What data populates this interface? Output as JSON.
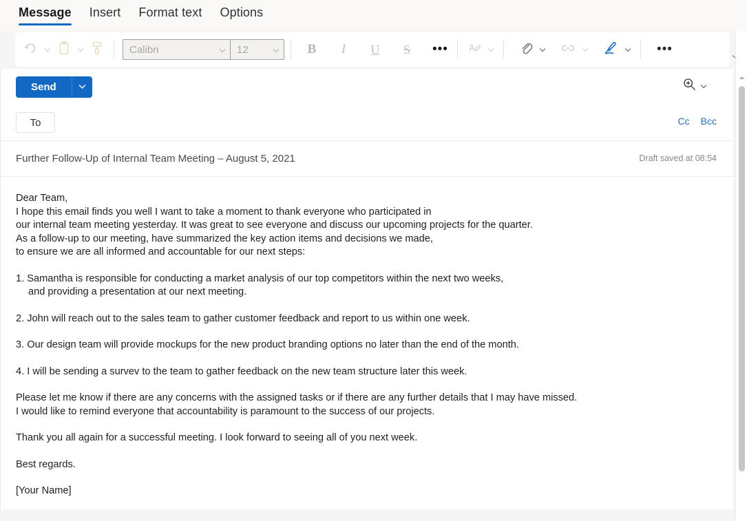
{
  "window": {
    "theme_accent": "#1268c3",
    "background": "#ffffff"
  },
  "tabs": [
    {
      "label": "Message",
      "selected": true
    },
    {
      "label": "Insert",
      "selected": false
    },
    {
      "label": "Format text",
      "selected": false
    },
    {
      "label": "Options",
      "selected": false
    }
  ],
  "ribbon": {
    "undo": {
      "name": "undo-icon",
      "enabled": false
    },
    "paste": {
      "name": "paste-clipboard-icon",
      "enabled": false
    },
    "format_painter": {
      "name": "format-painter-icon",
      "enabled": false
    },
    "font_name": {
      "value": "Calibri",
      "enabled": false
    },
    "font_size": {
      "value": "12",
      "enabled": false
    },
    "bold": {
      "label": "B",
      "enabled": false
    },
    "italic": {
      "label": "I",
      "enabled": false
    },
    "underline": {
      "label": "U",
      "enabled": false
    },
    "strikethrough": {
      "label": "S",
      "enabled": false
    },
    "more_font": {
      "label": "•••"
    },
    "font_color": {
      "name": "font-color-icon",
      "enabled": false
    },
    "attach": {
      "name": "attach-paperclip-icon",
      "enabled": true
    },
    "link": {
      "name": "link-icon",
      "enabled": false
    },
    "signature": {
      "name": "signature-pen-icon",
      "enabled": true,
      "color": "#1268c3"
    },
    "more_commands": {
      "label": "•••"
    },
    "collapse": {
      "name": "chevron-down-icon"
    }
  },
  "compose": {
    "send_label": "Send",
    "send_dropdown": "send-options-chevron",
    "zoom_icon": "zoom-in-icon",
    "to_label": "To",
    "to_value": "",
    "cc_label": "Cc",
    "bcc_label": "Bcc",
    "subject": "Further Follow-Up of Internal Team Meeting – August 5, 2021",
    "draft_status": "Draft saved at 08:54"
  },
  "message_body": {
    "salutation": "Dear Team,",
    "intro_line_1": "I hope this email finds you well I want to take a moment to thank everyone who participated in",
    "intro_line_2": "our internal team meeting yesterday. It was great to see everyone and discuss our upcoming projects for the quarter.",
    "intro_line_3": "As a follow-up to our meeting, have summarized the key action items and decisions we made,",
    "intro_line_4": "to ensure we are all informed and accountable for our next steps:",
    "item_1_line_1": "1. Samantha is responsible for conducting a market analysis of our top competitors within the next two weeks,",
    "item_1_line_2": "and providing a presentation at our next meeting.",
    "item_2": "2. John will reach out to the sales team to gather customer feedback and report to us within one week.",
    "item_3": "3. Our design team will provide mockups for the new product branding options no later than the end of the month.",
    "item_4": "4. I will be sending a survev to the team to gather feedback on the new team structure later this week.",
    "closing_line_1": "Please let me know if there are any concerns with the assigned tasks or if there are any further details that I may have missed.",
    "closing_line_2": "I would like to remind everyone that accountability is paramount to the success of our projects.",
    "thanks": "Thank you all again for a successful meeting. I look forward to seeing all of you next week.",
    "signoff": "Best regards.",
    "signature_name": "[Your Name]"
  }
}
